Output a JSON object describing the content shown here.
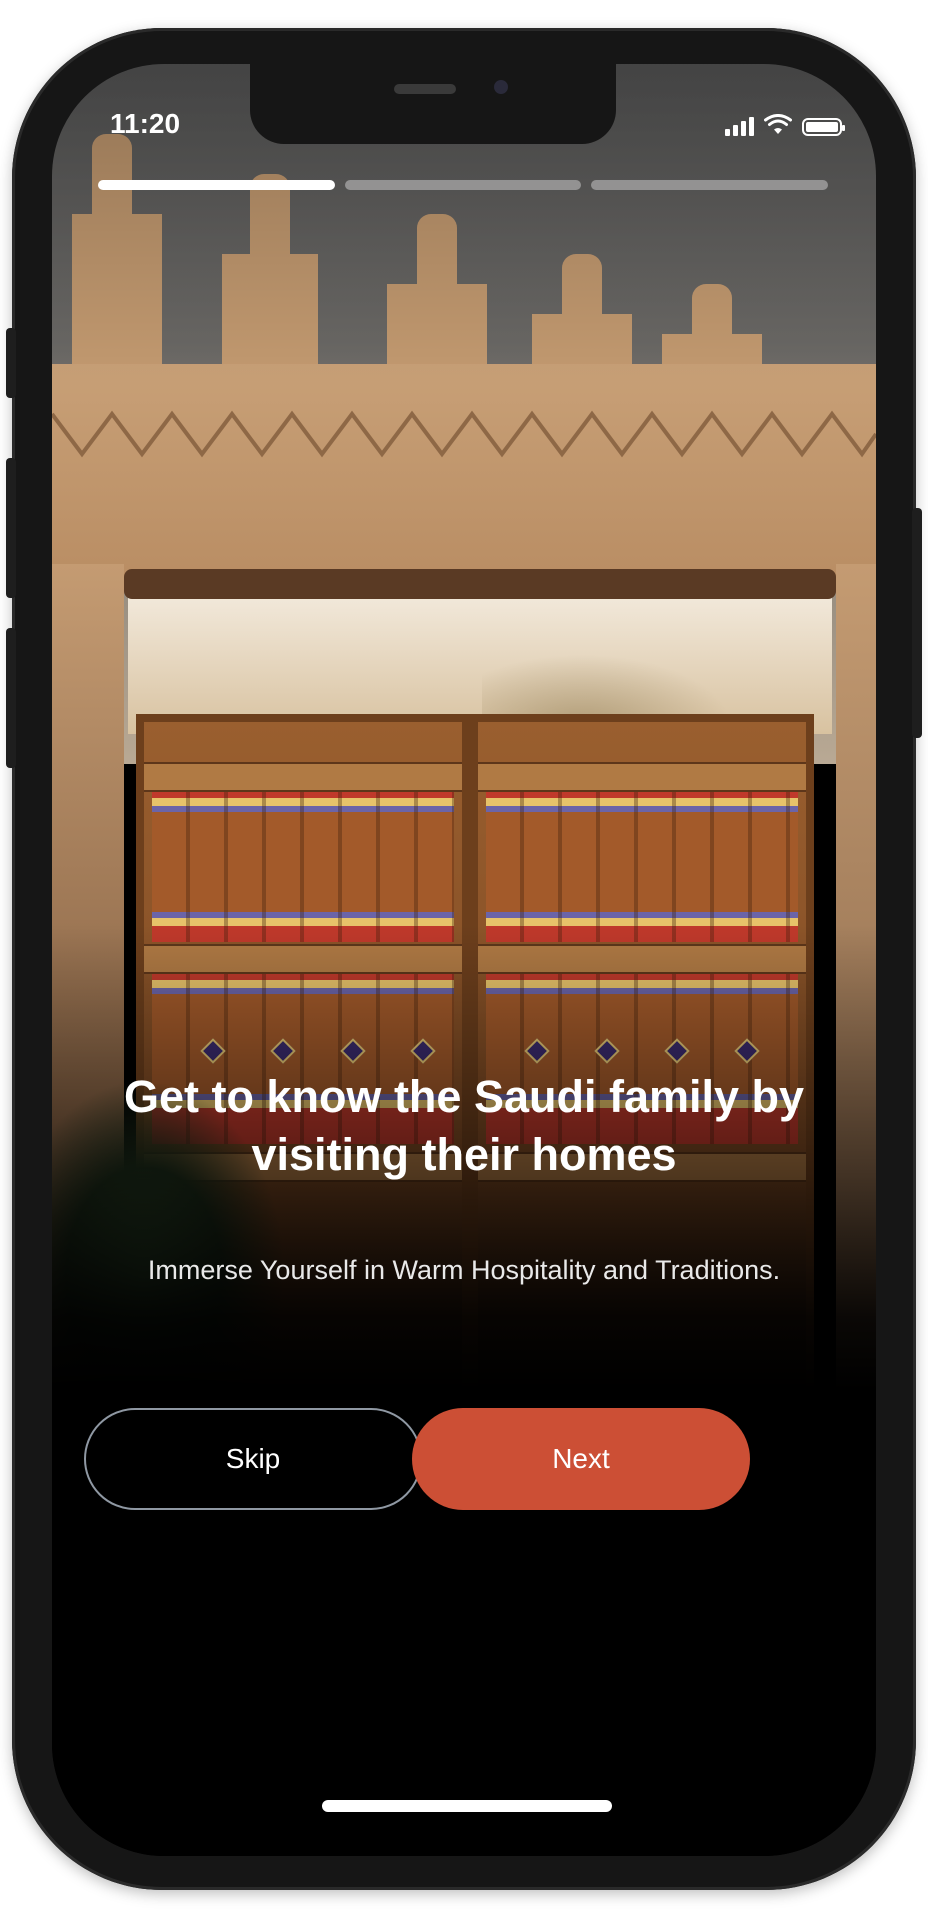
{
  "status_bar": {
    "time": "11:20",
    "icons": [
      "cellular-signal-icon",
      "wifi-icon",
      "battery-icon"
    ]
  },
  "progress": {
    "total_steps": 3,
    "current_step": 1
  },
  "onboarding": {
    "title": "Get to know the Saudi family by visiting their homes",
    "subtitle": "Immerse Yourself in Warm Hospitality and Traditions."
  },
  "actions": {
    "skip_label": "Skip",
    "next_label": "Next"
  },
  "colors": {
    "accent": "#cc4f35",
    "background": "#000000",
    "text": "#ffffff",
    "skip_border": "#8f98a3"
  }
}
